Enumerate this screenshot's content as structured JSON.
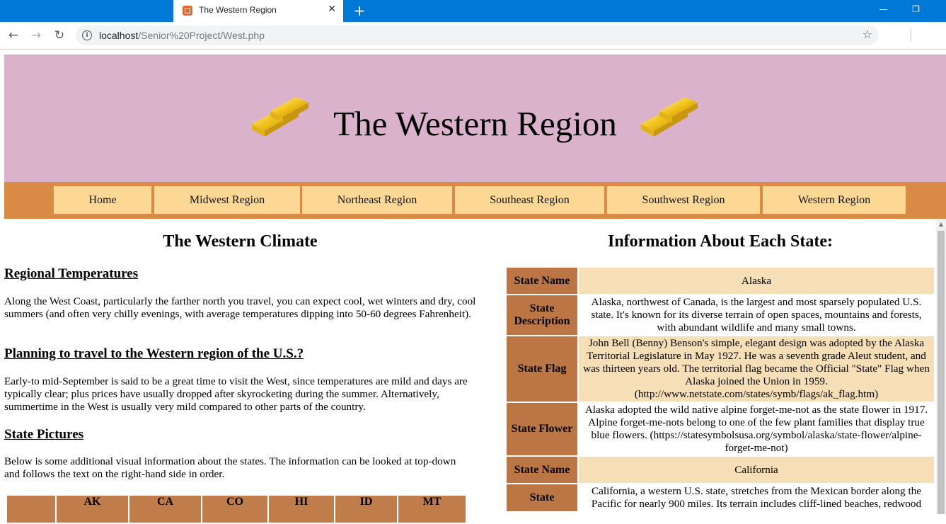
{
  "browser": {
    "tab_title": "The Western Region",
    "tab_close": "✕",
    "new_tab": "+",
    "url_host": "localhost",
    "url_path": "/Senior%20Project/West.php",
    "minimize": "—",
    "restore": "❐"
  },
  "header": {
    "title": "The Western Region"
  },
  "nav": {
    "items": [
      "Home",
      "Midwest Region",
      "Northeast Region",
      "Southeast Region",
      "Southwest Region",
      "Western Region"
    ]
  },
  "climate": {
    "heading": "The Western Climate",
    "sections": [
      {
        "title": "Regional Temperatures",
        "text": "Along the West Coast, particularly the farther north you travel, you can expect cool, wet winters and dry, cool summers (and often very chilly evenings, with average temperatures dipping into 50-60 degrees Fahrenheit)."
      },
      {
        "title": "Planning to travel to the Western region of the U.S.?",
        "text": "Early-to mid-September is said to be a great time to visit the West, since temperatures are mild and days are typically clear; plus prices have usually dropped after skyrocketing during the summer. Alternatively, summertime in the West is usually very mild compared to other parts of the country."
      },
      {
        "title": "State Pictures",
        "text": "Below is some additional visual information about the states. The information can be looked at top-down and follows the text on the right-hand side in order."
      }
    ],
    "picture_columns": [
      "",
      "AK",
      "CA",
      "CO",
      "HI",
      "ID",
      "MT"
    ]
  },
  "info": {
    "heading": "Information About Each State:",
    "rows": [
      {
        "label": "State Name",
        "value": "Alaska",
        "alt": true
      },
      {
        "label": "State Description",
        "value": "Alaska, northwest of Canada, is the largest and most sparsely populated U.S. state. It's known for its diverse terrain of open spaces, mountains and forests, with abundant wildlife and many small towns.",
        "alt": false
      },
      {
        "label": "State Flag",
        "value": "John Bell (Benny) Benson's simple, elegant design was adopted by the Alaska Territorial Legislature in May 1927. He was a seventh grade Aleut student, and was thirteen years old. The territorial flag became the Official \"State\" Flag when Alaska joined the Union in 1959. (http://www.netstate.com/states/symb/flags/ak_flag.htm)",
        "alt": true
      },
      {
        "label": "State Flower",
        "value": "Alaska adopted the wild native alpine forget-me-not as the state flower in 1917. Alpine forget-me-nots belong to one of the few plant families that display true blue flowers. (https://statesymbolsusa.org/symbol/alaska/state-flower/alpine-forget-me-not)",
        "alt": false
      },
      {
        "label": "State Name",
        "value": "California",
        "alt": true
      },
      {
        "label": "State",
        "value": "California, a western U.S. state, stretches from the Mexican border along the Pacific for nearly 900 miles. Its terrain includes cliff-lined beaches, redwood",
        "alt": false
      }
    ]
  }
}
